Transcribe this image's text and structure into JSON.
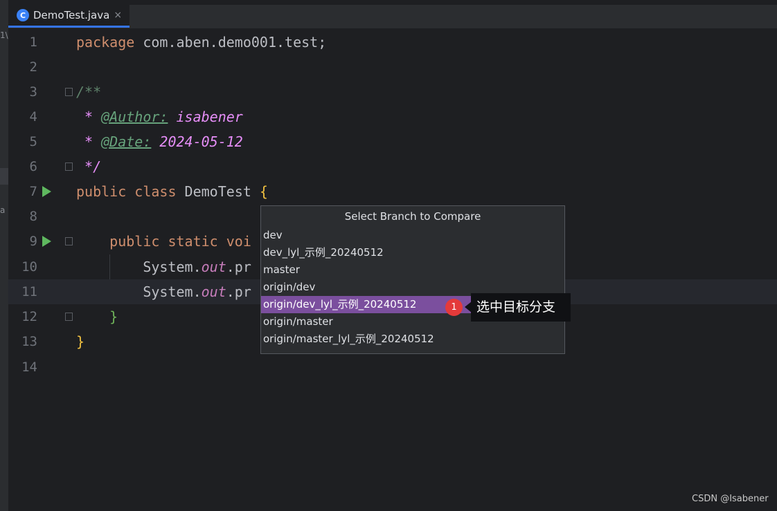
{
  "tab": {
    "icon_letter": "C",
    "filename": "DemoTest.java",
    "close": "×"
  },
  "gutter": {
    "icons": [
      "run-icon",
      "fold-icon"
    ]
  },
  "code": {
    "lines": [
      {
        "n": "1",
        "package_kw": "package",
        "package_name": " com.aben.demo001.test;"
      },
      {
        "n": "2"
      },
      {
        "n": "3",
        "text": "/**"
      },
      {
        "n": "4",
        "star": " * ",
        "tag": "@Author:",
        "value": " isabener"
      },
      {
        "n": "5",
        "star": " * ",
        "tag": "@Date:",
        "value": " 2024-05-12"
      },
      {
        "n": "6",
        "text": " */"
      },
      {
        "n": "7",
        "kw1": "public",
        "kw2": " class",
        "name": " DemoTest ",
        "brace": "{"
      },
      {
        "n": "8"
      },
      {
        "n": "9",
        "indent": "    ",
        "kw1": "public",
        "kw2": " static",
        "kw3": " voi"
      },
      {
        "n": "10",
        "indent": "        ",
        "sys": "System.",
        "field": "out",
        "rest": ".pr"
      },
      {
        "n": "11",
        "indent": "        ",
        "sys": "System.",
        "field": "out",
        "rest": ".pr"
      },
      {
        "n": "12",
        "indent": "    ",
        "brace": "}"
      },
      {
        "n": "13",
        "brace": "}"
      },
      {
        "n": "14"
      }
    ]
  },
  "popup": {
    "title": "Select Branch to Compare",
    "branches": [
      "dev",
      "dev_lyl_示例_20240512",
      "master",
      "origin/dev",
      "origin/dev_lyl_示例_20240512",
      "origin/master",
      "origin/master_lyl_示例_20240512"
    ],
    "selected_index": 4
  },
  "annotation": {
    "badge": "1",
    "text": "选中目标分支"
  },
  "side_fragments": {
    "top": "1\\",
    "mid": "a"
  },
  "watermark": "CSDN @Isabener",
  "colors": {
    "selection": "#7b4f9e",
    "badge": "#e43a3a",
    "run": "#5fb85f",
    "accent": "#3574f0"
  }
}
